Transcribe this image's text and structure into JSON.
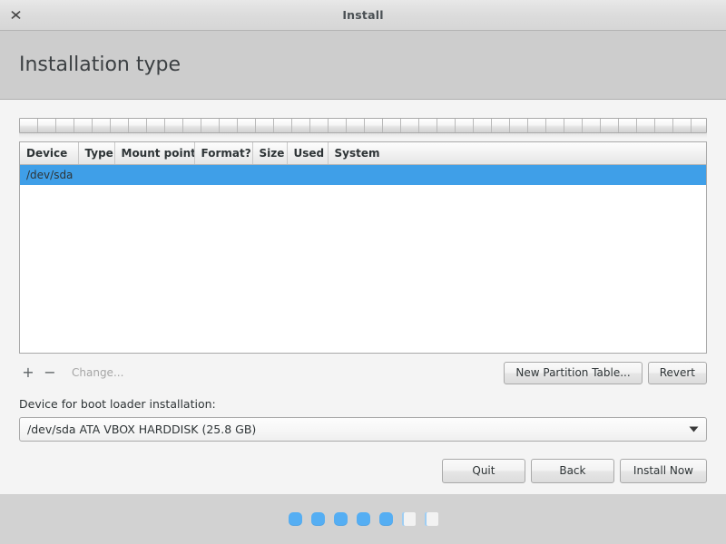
{
  "window": {
    "title": "Install",
    "close_icon": "close-icon"
  },
  "page": {
    "title": "Installation type"
  },
  "partition_table": {
    "columns": [
      "Device",
      "Type",
      "Mount point",
      "Format?",
      "Size",
      "Used",
      "System"
    ],
    "rows": [
      {
        "selected": true,
        "cells": [
          "/dev/sda",
          "",
          "",
          "",
          "",
          "",
          ""
        ]
      }
    ]
  },
  "toolbar": {
    "add_label": "+",
    "remove_label": "−",
    "change_label": "Change...",
    "new_partition_table_label": "New Partition Table...",
    "revert_label": "Revert"
  },
  "bootloader": {
    "label": "Device for boot loader installation:",
    "selected_value": "/dev/sda  ATA VBOX HARDDISK (25.8 GB)"
  },
  "nav": {
    "quit_label": "Quit",
    "back_label": "Back",
    "install_label": "Install Now"
  },
  "progress": {
    "total_steps": 7,
    "completed_steps": 5,
    "active_color": "#55aef3",
    "inactive_color": "#f2f2f2"
  },
  "colors": {
    "selection_blue": "#3f9fe8",
    "header_band": "#cdcdcd",
    "body": "#f4f4f4",
    "footer": "#d2d2d2"
  }
}
